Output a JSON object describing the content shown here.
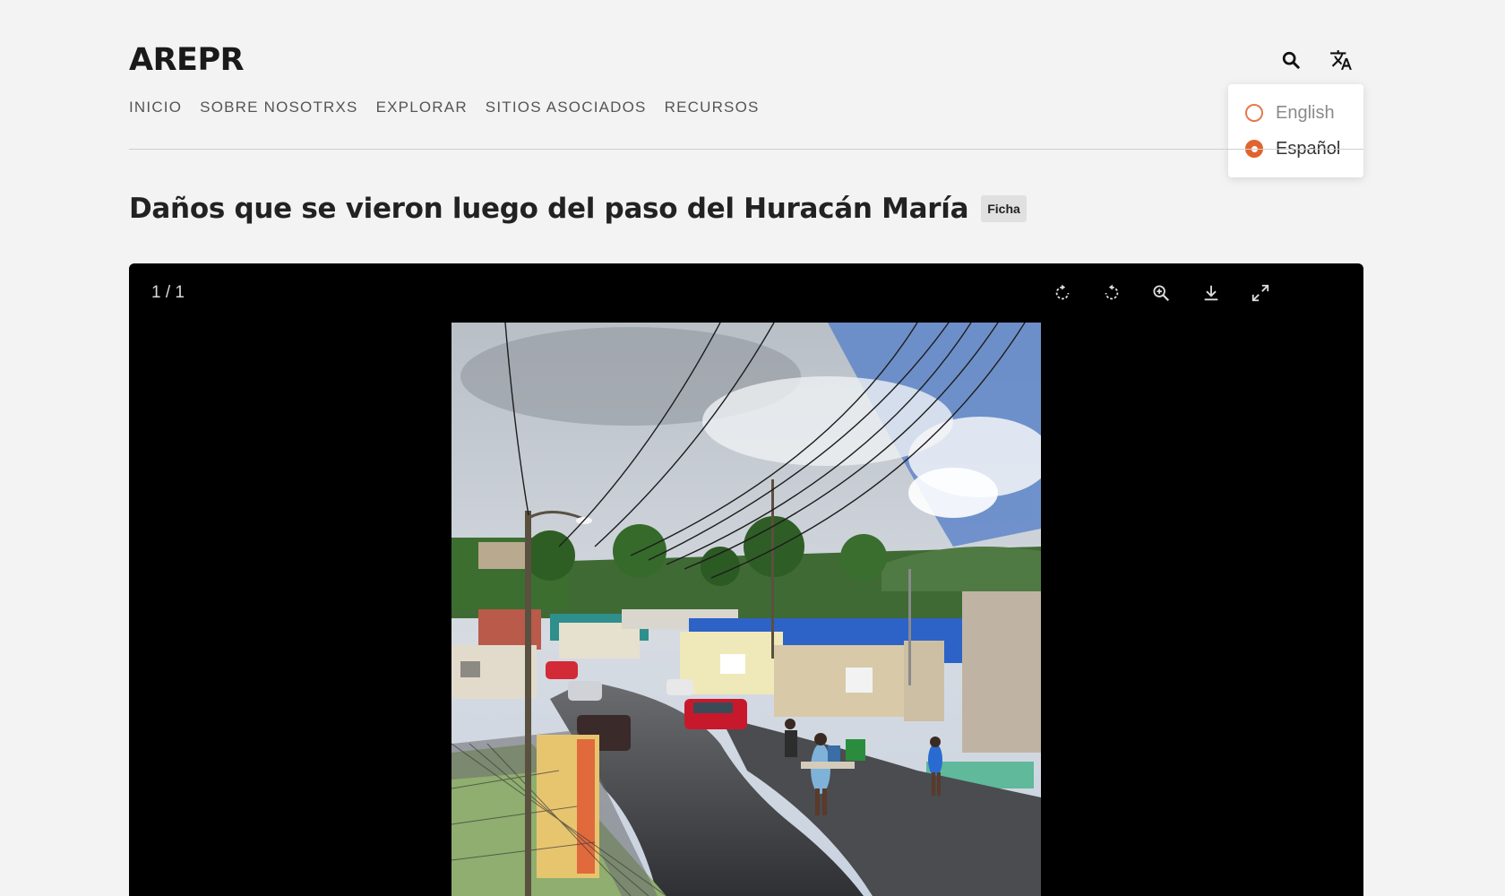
{
  "site": {
    "logo": "AREPR"
  },
  "nav": {
    "items": [
      "INICIO",
      "SOBRE NOSOTRXS",
      "EXPLORAR",
      "SITIOS ASOCIADOS",
      "RECURSOS"
    ]
  },
  "header_icons": {
    "search": "search-icon",
    "language": "translate-icon"
  },
  "language_menu": {
    "options": [
      {
        "label": "English",
        "selected": false
      },
      {
        "label": "Español",
        "selected": true
      }
    ],
    "accent_color": "#e1642e"
  },
  "page": {
    "title": "Daños que se vieron luego del paso del Huracán María",
    "badge": "Ficha"
  },
  "viewer": {
    "counter": "1 / 1",
    "tools": [
      "rotate-clockwise-icon",
      "rotate-counterclockwise-icon",
      "zoom-in-icon",
      "download-icon",
      "fullscreen-icon"
    ]
  }
}
